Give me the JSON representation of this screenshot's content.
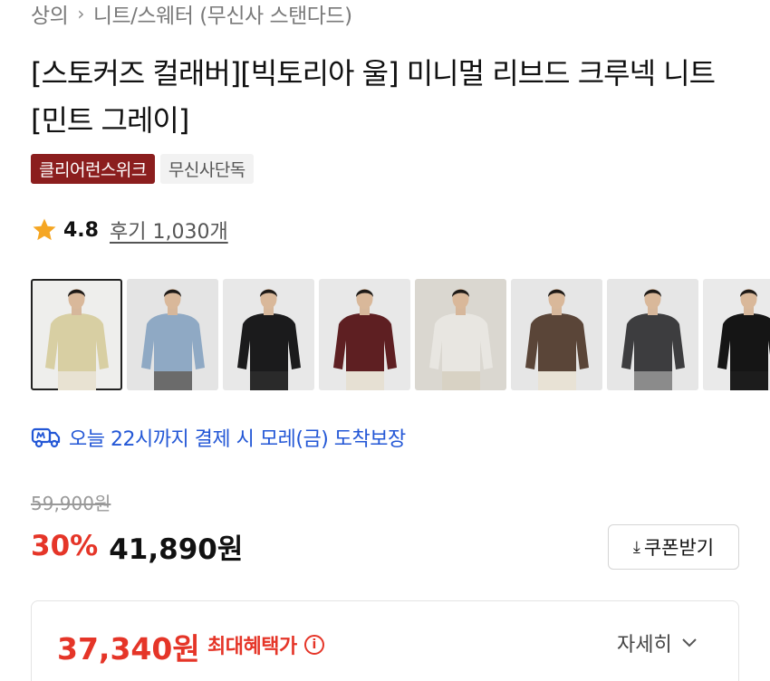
{
  "breadcrumb": {
    "items": [
      "상의",
      "니트/스웨터 (무신사 스탠다드)"
    ],
    "separator": "›"
  },
  "product": {
    "title": "[스토커즈 컬래버][빅토리아 울] 미니멀 리브드 크루넥 니트 [민트 그레이]",
    "badges": [
      "클리어런스위크",
      "무신사단독"
    ],
    "rating": "4.8",
    "review_text": "후기 1,030개"
  },
  "thumbnails": [
    {
      "name": "thumb-1",
      "sweater_color": "#d8cfa3",
      "bg": "#eeeeec",
      "pants": "#e8e2d2",
      "active": true
    },
    {
      "name": "thumb-2",
      "sweater_color": "#8fa9c4",
      "bg": "#e4e4e4",
      "pants": "#6b6b6b",
      "active": false
    },
    {
      "name": "thumb-3",
      "sweater_color": "#1b1b1c",
      "bg": "#e8e8e8",
      "pants": "#2a2a2a",
      "active": false
    },
    {
      "name": "thumb-4",
      "sweater_color": "#5e1f22",
      "bg": "#e8e8e8",
      "pants": "#e6e0d3",
      "active": false
    },
    {
      "name": "thumb-5",
      "sweater_color": "#e8e6e1",
      "bg": "#dad7d0",
      "pants": "#d8d2c4",
      "active": false
    },
    {
      "name": "thumb-6",
      "sweater_color": "#5a4538",
      "bg": "#e6e6e6",
      "pants": "#e8e2d5",
      "active": false
    },
    {
      "name": "thumb-7",
      "sweater_color": "#3d3d3f",
      "bg": "#e6e6e6",
      "pants": "#8b8b8b",
      "active": false
    },
    {
      "name": "thumb-8",
      "sweater_color": "#151515",
      "bg": "#eaeaea",
      "pants": "#1c1c1c",
      "active": false
    }
  ],
  "delivery": {
    "text": "오늘 22시까지 결제 시 모레(금) 도착보장",
    "color": "#2357d6"
  },
  "pricing": {
    "original": "59,900원",
    "discount": "30%",
    "sale": "41,890원",
    "coupon_button": "쿠폰받기",
    "coupon_icon": "⤓"
  },
  "benefit": {
    "price": "37,340원",
    "label": "최대혜택가",
    "info_icon": "i",
    "more_label": "자세히"
  },
  "colors": {
    "accent_red": "#e53528",
    "badge_red": "#8b1e1e",
    "star": "#f5a623"
  }
}
